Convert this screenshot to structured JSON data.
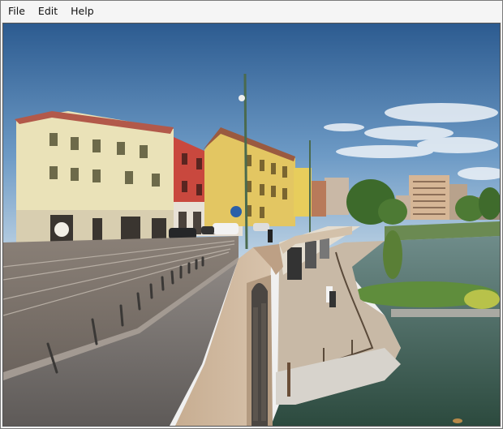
{
  "menubar": {
    "items": [
      {
        "label": "File"
      },
      {
        "label": "Edit"
      },
      {
        "label": "Help"
      }
    ]
  },
  "viewer": {
    "content": "street-view-photo"
  },
  "colors": {
    "sky_top": "#2f5f93",
    "sky_bottom": "#a9c6df",
    "water": "#3f5a4c",
    "bridge": "#cdb79d"
  }
}
